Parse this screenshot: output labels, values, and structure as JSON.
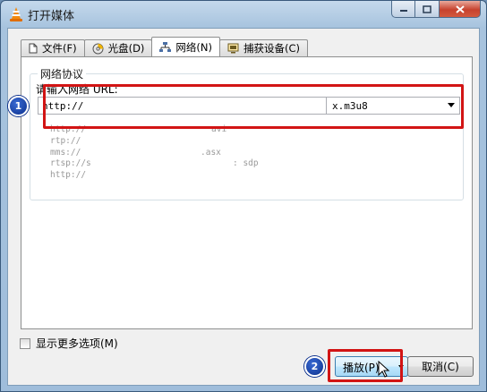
{
  "window": {
    "title": "打开媒体"
  },
  "tabs": [
    {
      "label": "文件(F)",
      "icon": "file-icon"
    },
    {
      "label": "光盘(D)",
      "icon": "disc-icon"
    },
    {
      "label": "网络(N)",
      "icon": "network-icon"
    },
    {
      "label": "捕获设备(C)",
      "icon": "capture-device-icon"
    }
  ],
  "network": {
    "group_title": "网络协议",
    "prompt": "请输入网络 URL:",
    "url_value": "http://",
    "combo_value": "x.m3u8",
    "examples": [
      {
        "left": "http://",
        "right": "avi"
      },
      {
        "left": "rtp://",
        "right": ""
      },
      {
        "left": "mms://",
        "right": ".asx"
      },
      {
        "left": "rtsp://s",
        "right": ": sdp"
      },
      {
        "left": "http://",
        "right": ""
      }
    ]
  },
  "options": {
    "show_more": "显示更多选项(M)"
  },
  "buttons": {
    "play": "播放(P)",
    "cancel": "取消(C)"
  },
  "annotations": {
    "step1": "1",
    "step2": "2"
  },
  "colors": {
    "annotation_red": "#d21414",
    "callout_blue": "#0b2f8c"
  }
}
